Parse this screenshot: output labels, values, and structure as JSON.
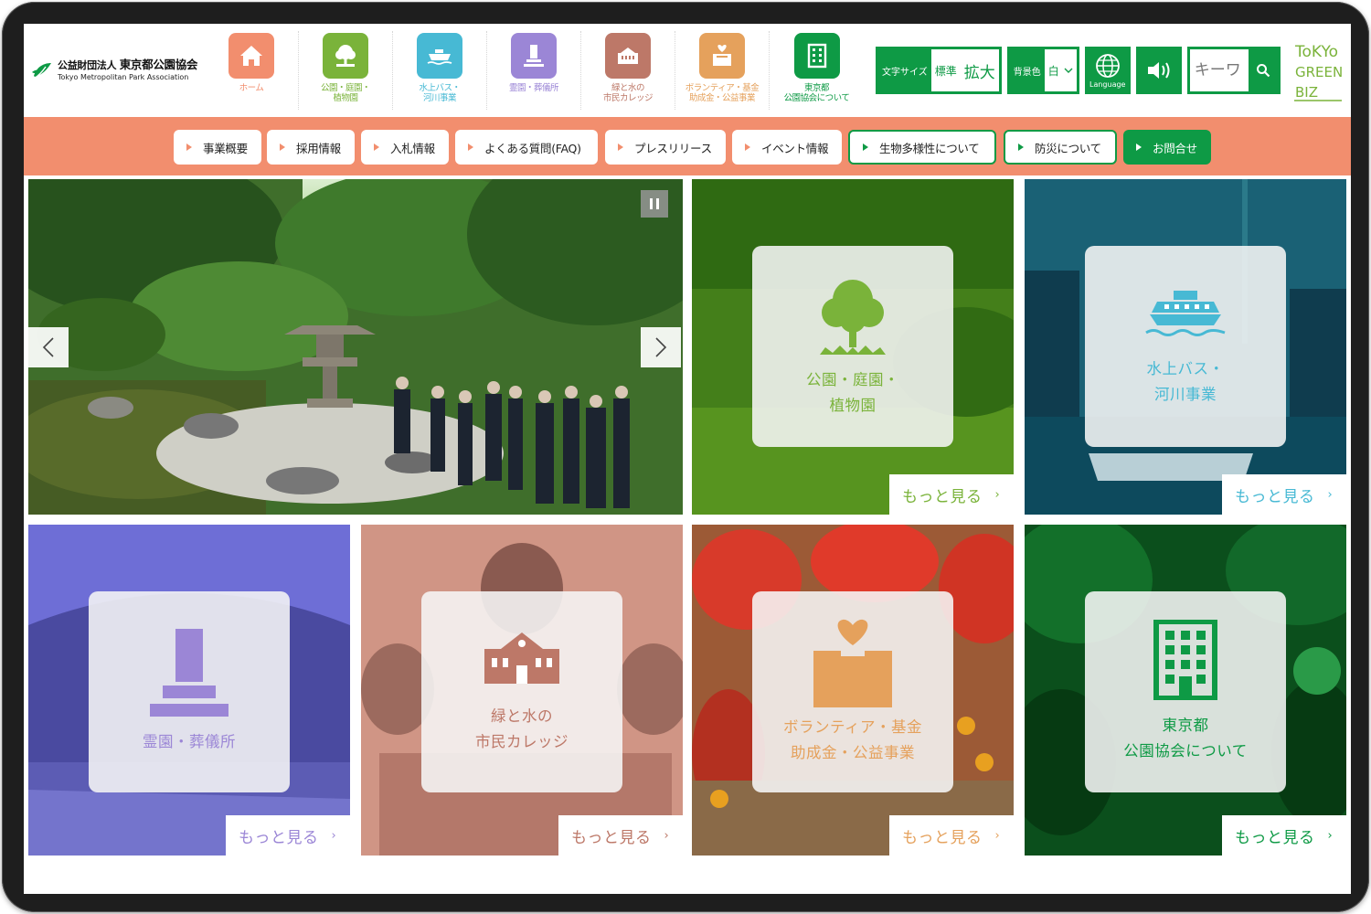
{
  "logo": {
    "line1_prefix": "公益財団法人",
    "line1_org": "東京都公園協会",
    "line2": "Tokyo Metropolitan Park Association"
  },
  "nav_icons": [
    {
      "label": "ホーム",
      "icon": "home-icon",
      "color": "#f28e6e"
    },
    {
      "label": "公園・庭園・\n植物園",
      "icon": "tree-icon",
      "color": "#7ab33a"
    },
    {
      "label": "水上バス・\n河川事業",
      "icon": "ship-icon",
      "color": "#47b9d4"
    },
    {
      "label": "霊園・葬儀所",
      "icon": "grave-icon",
      "color": "#9b86d6"
    },
    {
      "label": "緑と水の\n市民カレッジ",
      "icon": "school-icon",
      "color": "#bd7868"
    },
    {
      "label": "ボランティア・基金\n助成金・公益事業",
      "icon": "donation-box-icon",
      "color": "#e5a15c"
    },
    {
      "label": "東京都\n公園協会について",
      "icon": "building-icon",
      "color": "#0e9a45"
    }
  ],
  "tools": {
    "font_size_label": "文字サイズ",
    "font_standard": "標準",
    "font_large": "拡大",
    "bg_label": "背景色",
    "bg_value": "白",
    "language_label": "Language",
    "search_placeholder": "キーワ"
  },
  "tgb_logo": {
    "line1": "ToKYo",
    "line2": "GREEN",
    "line3": "BIZ"
  },
  "link_bar": [
    {
      "label": "事業概要",
      "style": "plain"
    },
    {
      "label": "採用情報",
      "style": "plain"
    },
    {
      "label": "入札情報",
      "style": "plain"
    },
    {
      "label": "よくある質問(FAQ)",
      "style": "plain"
    },
    {
      "label": "プレスリリース",
      "style": "plain"
    },
    {
      "label": "イベント情報",
      "style": "plain"
    },
    {
      "label": "生物多様性について",
      "style": "outlined"
    },
    {
      "label": "防災について",
      "style": "outlined"
    },
    {
      "label": "お問合せ",
      "style": "filled"
    }
  ],
  "tiles": [
    {
      "title": "公園・庭園・\n植物園",
      "more": "もっと見る",
      "icon": "tree-icon",
      "color": "#7ab33a"
    },
    {
      "title": "水上バス・\n河川事業",
      "more": "もっと見る",
      "icon": "ship-icon",
      "color": "#47b9d4"
    },
    {
      "title": "霊園・葬儀所",
      "more": "もっと見る",
      "icon": "grave-icon",
      "color": "#9b86d6"
    },
    {
      "title": "緑と水の\n市民カレッジ",
      "more": "もっと見る",
      "icon": "school-icon",
      "color": "#bd7868"
    },
    {
      "title": "ボランティア・基金\n助成金・公益事業",
      "more": "もっと見る",
      "icon": "donation-box-icon",
      "color": "#e5a15c"
    },
    {
      "title": "東京都\n公園協会について",
      "more": "もっと見る",
      "icon": "building-icon",
      "color": "#0e9a45"
    }
  ],
  "slider": {
    "image": "japanese-garden-tour-photo"
  },
  "colors": {
    "brand_green": "#0e9a45",
    "accent_orange": "#f28e6e"
  }
}
